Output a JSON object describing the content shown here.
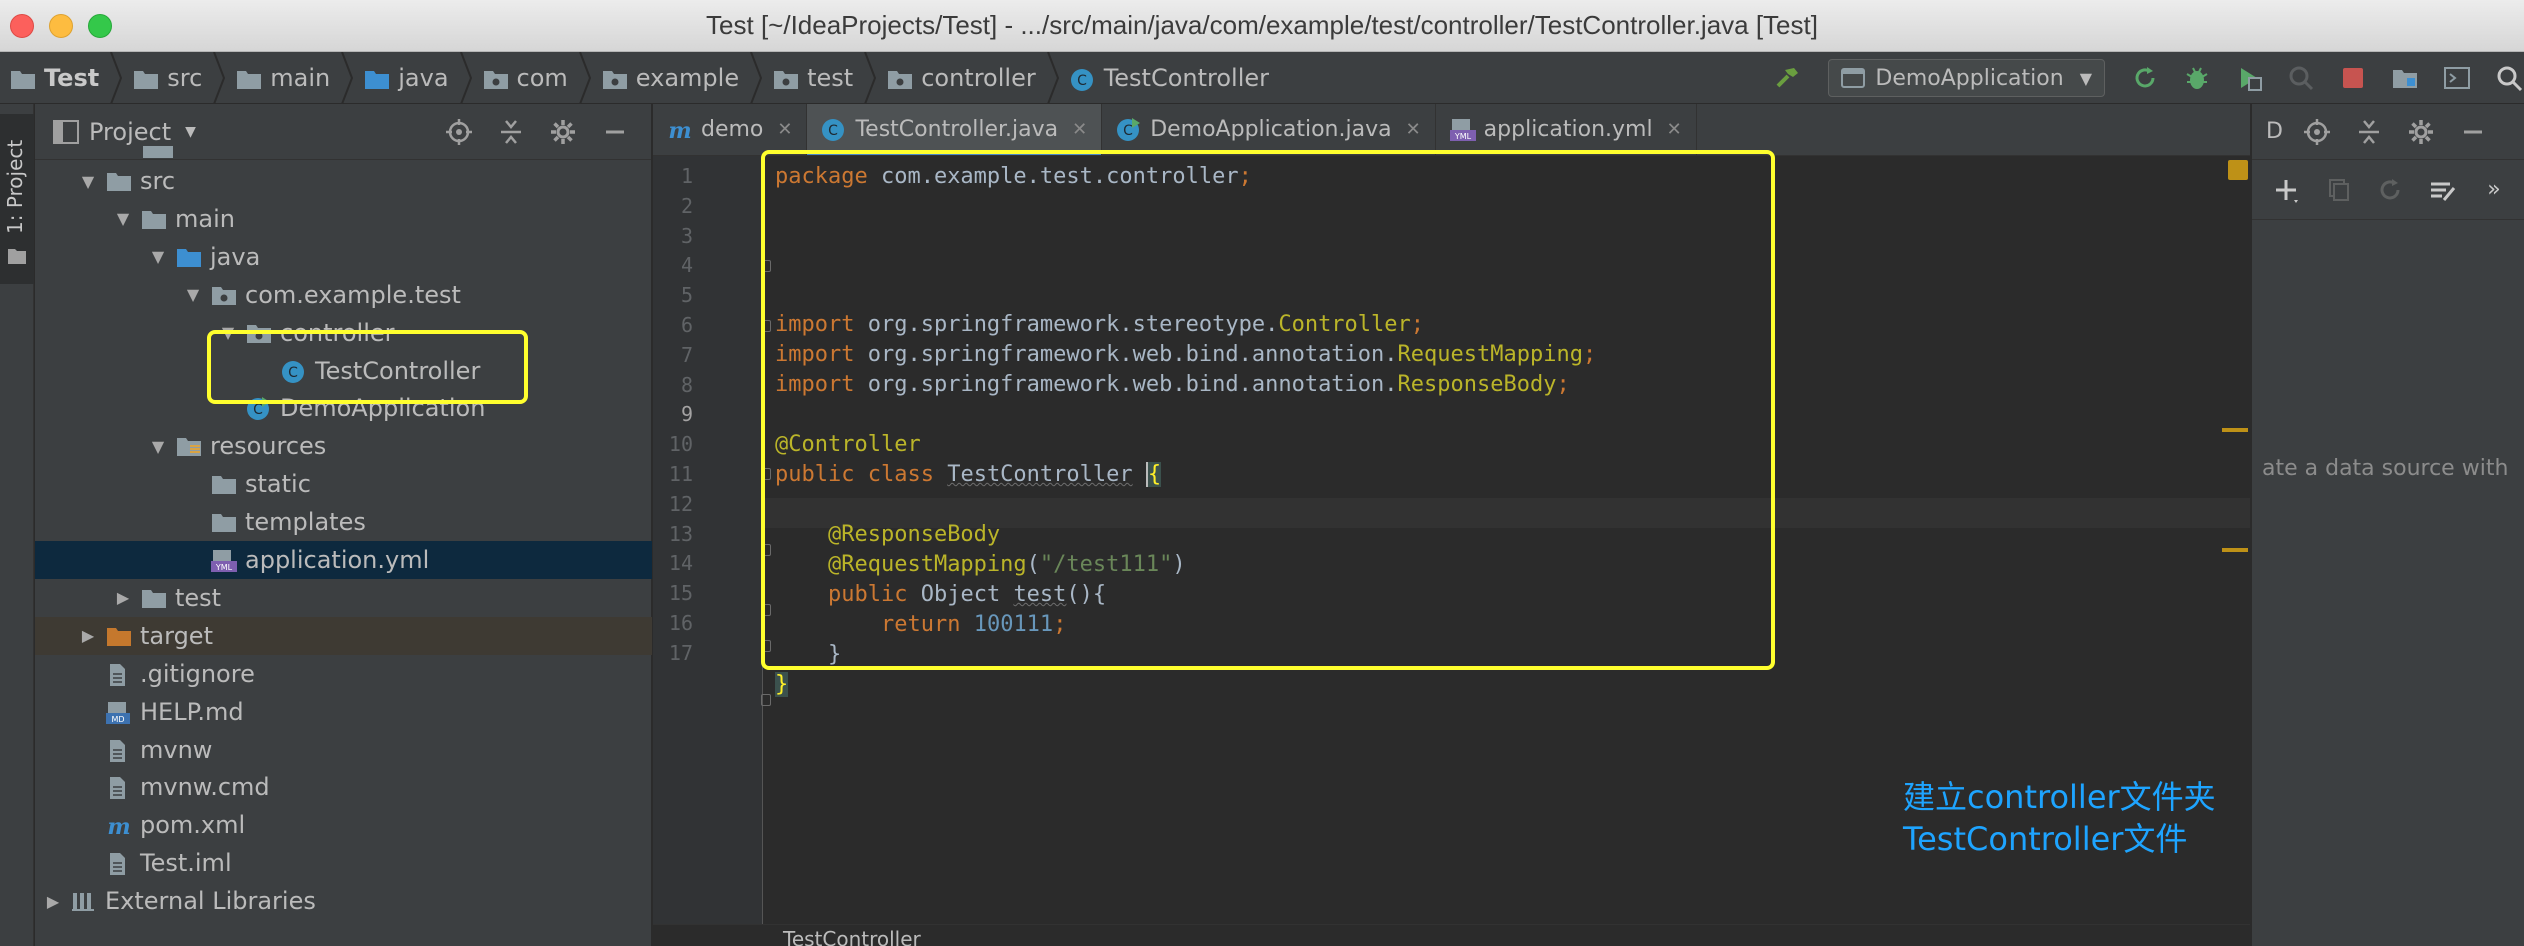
{
  "window": {
    "title": "Test [~/IdeaProjects/Test] - .../src/main/java/com/example/test/controller/TestController.java [Test]"
  },
  "breadcrumbs": [
    "Test",
    "src",
    "main",
    "java",
    "com",
    "example",
    "test",
    "controller",
    "TestController"
  ],
  "toolbar": {
    "run_config": "DemoApplication"
  },
  "left_strip": {
    "tab_label": "1: Project"
  },
  "project_panel": {
    "title": "Project",
    "tree": [
      {
        "label": "src",
        "indent": 1,
        "arrow": "down",
        "icon": "folder"
      },
      {
        "label": "main",
        "indent": 2,
        "arrow": "down",
        "icon": "folder"
      },
      {
        "label": "java",
        "indent": 3,
        "arrow": "down",
        "icon": "folder-blue"
      },
      {
        "label": "com.example.test",
        "indent": 4,
        "arrow": "down",
        "icon": "package"
      },
      {
        "label": "controller",
        "indent": 5,
        "arrow": "down",
        "icon": "package"
      },
      {
        "label": "TestController",
        "indent": 6,
        "arrow": "none",
        "icon": "class"
      },
      {
        "label": "DemoApplication",
        "indent": 5,
        "arrow": "none",
        "icon": "class-run"
      },
      {
        "label": "resources",
        "indent": 3,
        "arrow": "down",
        "icon": "folder-res"
      },
      {
        "label": "static",
        "indent": 4,
        "arrow": "none",
        "icon": "folder"
      },
      {
        "label": "templates",
        "indent": 4,
        "arrow": "none",
        "icon": "folder"
      },
      {
        "label": "application.yml",
        "indent": 4,
        "arrow": "none",
        "icon": "yml",
        "selected": true
      },
      {
        "label": "test",
        "indent": 2,
        "arrow": "right",
        "icon": "folder"
      },
      {
        "label": "target",
        "indent": 1,
        "arrow": "right",
        "icon": "folder-orange",
        "excluded": true
      },
      {
        "label": ".gitignore",
        "indent": 1,
        "arrow": "none",
        "icon": "file"
      },
      {
        "label": "HELP.md",
        "indent": 1,
        "arrow": "none",
        "icon": "md"
      },
      {
        "label": "mvnw",
        "indent": 1,
        "arrow": "none",
        "icon": "file"
      },
      {
        "label": "mvnw.cmd",
        "indent": 1,
        "arrow": "none",
        "icon": "file"
      },
      {
        "label": "pom.xml",
        "indent": 1,
        "arrow": "none",
        "icon": "maven"
      },
      {
        "label": "Test.iml",
        "indent": 1,
        "arrow": "none",
        "icon": "file"
      },
      {
        "label": "External Libraries",
        "indent": 0,
        "arrow": "right",
        "icon": "libs"
      }
    ]
  },
  "editor": {
    "tabs": [
      {
        "label": "demo",
        "icon": "maven"
      },
      {
        "label": "TestController.java",
        "icon": "class",
        "active": true
      },
      {
        "label": "DemoApplication.java",
        "icon": "class-run"
      },
      {
        "label": "application.yml",
        "icon": "yml"
      }
    ],
    "line_count": 17,
    "current_line": 9,
    "code": {
      "l1": [
        "package",
        " com.example.test.controller",
        ";"
      ],
      "l4": [
        "import",
        " org.springframework.stereotype.",
        "Controller",
        ";"
      ],
      "l5": [
        "import",
        " org.springframework.web.bind.annotation.",
        "RequestMapping",
        ";"
      ],
      "l6": [
        "import",
        " org.springframework.web.bind.annotation.",
        "ResponseBody",
        ";"
      ],
      "l8": "@Controller",
      "l9": [
        "public class",
        "TestController",
        "{"
      ],
      "l11": "@ResponseBody",
      "l12": [
        "@RequestMapping",
        "\"/test111\"",
        ")"
      ],
      "l13": [
        "public",
        " Object ",
        "test",
        "(){"
      ],
      "l14": [
        "return",
        "100111",
        ";"
      ],
      "l15": "}",
      "l16": "}"
    },
    "note_line1": "建立controller文件夹",
    "note_line2": "TestController文件",
    "bottom_breadcrumb": "TestController"
  },
  "right_panel": {
    "title": "D",
    "hint": "ate a data source with"
  },
  "colors": {
    "highlight_box": "#ffff2e",
    "note_text": "#1ea4ff",
    "keyword": "#cc7832",
    "annotation": "#bbb529",
    "string": "#6a8759",
    "number": "#6897bb"
  }
}
